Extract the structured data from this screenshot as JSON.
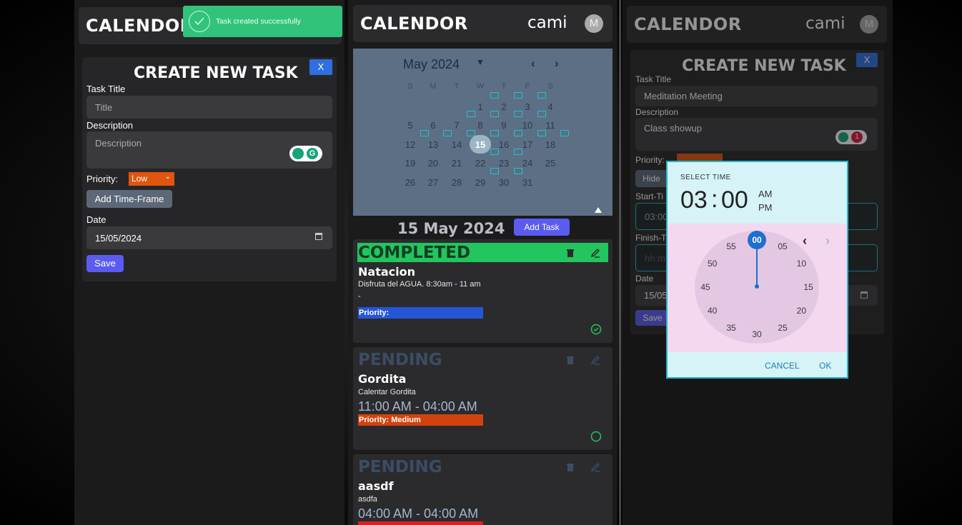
{
  "brand": "CALENDOR",
  "user": {
    "name": "cami",
    "initial": "M"
  },
  "toast": {
    "message": "Task created successfully",
    "color": "#31c37a"
  },
  "left_form": {
    "title": "CREATE NEW TASK",
    "close_label": "X",
    "task_title_label": "Task Title",
    "task_title_placeholder": "Title",
    "description_label": "Description",
    "description_placeholder": "Description",
    "priority_label": "Priority:",
    "priority_value": "Low",
    "add_timeframe_label": "Add Time-Frame",
    "date_label": "Date",
    "date_value": "15/05/2024",
    "save_label": "Save"
  },
  "calendar": {
    "month": "May 2024",
    "prev": "‹",
    "next": "›",
    "weekdays": [
      "S",
      "M",
      "T",
      "W",
      "T",
      "F",
      "S"
    ],
    "weeks": [
      [
        "",
        "",
        "",
        "1",
        "2",
        "3",
        "4"
      ],
      [
        "5",
        "6",
        "7",
        "8",
        "9",
        "10",
        "11"
      ],
      [
        "12",
        "13",
        "14",
        "15",
        "16",
        "17",
        "18"
      ],
      [
        "19",
        "20",
        "21",
        "22",
        "23",
        "24",
        "25"
      ],
      [
        "26",
        "27",
        "28",
        "29",
        "30",
        "31",
        ""
      ]
    ],
    "selected_day": "15",
    "task_days": [
      "1",
      "2",
      "3",
      "7",
      "8",
      "9",
      "10",
      "15",
      "16",
      "17",
      "18",
      "12",
      "13",
      "14",
      "22",
      "23",
      "29",
      "30"
    ]
  },
  "selected_date_title": "15 May 2024",
  "add_task_label": "Add Task",
  "tasks": [
    {
      "status": "COMPLETED",
      "title": "Natacion",
      "description": "Disfruta del AGUA. 8:30am - 11 am",
      "time": "-",
      "priority": "Priority:",
      "status_color": "#22c55e",
      "priority_color": "#2556d8"
    },
    {
      "status": "PENDING",
      "title": "Gordita",
      "description": "Calentar Gordita",
      "time": "11:00 AM - 04:00 AM",
      "priority": "Priority: Medium",
      "status_color": "#3c4c63",
      "priority_color": "#d2420f"
    },
    {
      "status": "PENDING",
      "title": "aasdf",
      "description": "asdfa",
      "time": "04:00 AM - 04:00 AM",
      "priority": "",
      "status_color": "#3c4c63",
      "priority_color": "#d62222"
    }
  ],
  "right_form": {
    "title": "CREATE NEW TASK",
    "close_label": "X",
    "task_title_label": "Task Title",
    "task_title_value": "Meditation Meeting",
    "description_label": "Description",
    "description_value": "Class showup",
    "priority_label": "Priority:",
    "hide_label": "Hide",
    "start_label": "Start-Ti",
    "start_value": "03:00",
    "finish_label": "Finish-T",
    "finish_placeholder": "hh:m",
    "date_label": "Date",
    "date_value": "15/05",
    "save_label": "Save",
    "grammarly_count": "1"
  },
  "time_picker": {
    "label": "SELECT TIME",
    "hour": "03",
    "separator": ":",
    "minute": "00",
    "am": "AM",
    "pm": "PM",
    "selected_minute": "00",
    "minutes": [
      "00",
      "05",
      "10",
      "15",
      "20",
      "25",
      "30",
      "35",
      "40",
      "45",
      "50",
      "55"
    ],
    "cancel_label": "CANCEL",
    "ok_label": "OK"
  }
}
